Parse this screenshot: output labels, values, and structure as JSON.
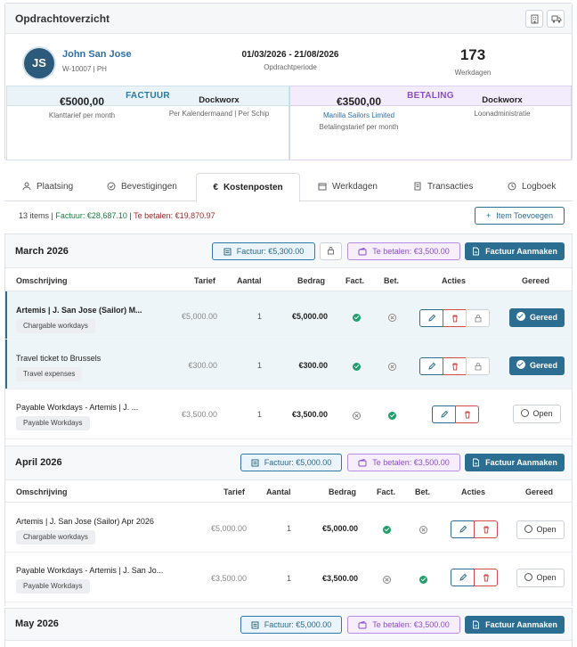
{
  "header": {
    "title": "Opdrachtoverzicht"
  },
  "contractor": {
    "initials": "JS",
    "name": "John San Jose",
    "meta": "W-10007 | PH"
  },
  "period": {
    "range": "01/03/2026 - 21/08/2026",
    "label": "Opdrachtperiode"
  },
  "workdays": {
    "value": "173",
    "label": "Werkdagen"
  },
  "factuur": {
    "heading": "FACTUUR",
    "rate": "€5000,00",
    "rate_label": "Klanttarief per month",
    "client": "Dockworx",
    "client_label": "Per Kalendermaand | Per Schip"
  },
  "betaling": {
    "heading": "BETALING",
    "rate": "€3500,00",
    "payer": "Manilla Sailors Limited",
    "rate_label": "Betalingstarief per month",
    "admin": "Dockworx",
    "admin_label": "Loonadministratie"
  },
  "tabs": [
    "Plaatsing",
    "Bevestigingen",
    "Kostenposten",
    "Werkdagen",
    "Transacties",
    "Logboek"
  ],
  "summary": {
    "items": "13 items",
    "factuur": "Factuur: €28,687.10",
    "betalen": "Te betalen: €19,870.97"
  },
  "add_button": "Item Toevoegen",
  "columns": {
    "desc": "Omschrijving",
    "rate": "Tarief",
    "qty": "Aantal",
    "amount": "Bedrag",
    "fact": "Fact.",
    "bet": "Bet.",
    "actions": "Acties",
    "done": "Gereed"
  },
  "make_invoice": "Factuur Aanmaken",
  "months": [
    {
      "title": "March 2026",
      "factuur": "Factuur: €5,300.00",
      "betalen": "Te betalen: €3,500.00",
      "rows": [
        {
          "desc": "Artemis | J. San Jose (Sailor) M...",
          "tag": "Chargable workdays",
          "rate": "€5,000.00",
          "qty": "1",
          "amount": "€5,000.00",
          "done": "Gereed"
        },
        {
          "desc": "Travel ticket to Brussels",
          "tag": "Travel expenses",
          "rate": "€300.00",
          "qty": "1",
          "amount": "€300.00",
          "done": "Gereed"
        },
        {
          "desc": "Payable Workdays - Artemis | J. ...",
          "tag": "Payable Workdays",
          "rate": "€3,500.00",
          "qty": "1",
          "amount": "€3,500.00",
          "done": "Open"
        }
      ]
    },
    {
      "title": "April 2026",
      "factuur": "Factuur: €5,000.00",
      "betalen": "Te betalen: €3,500.00",
      "rows": [
        {
          "desc": "Artemis | J. San Jose (Sailor) Apr 2026",
          "tag": "Chargable workdays",
          "rate": "€5,000.00",
          "qty": "1",
          "amount": "€5,000.00",
          "done": "Open"
        },
        {
          "desc": "Payable Workdays - Artemis | J. San Jo...",
          "tag": "Payable Workdays",
          "rate": "€3,500.00",
          "qty": "1",
          "amount": "€3,500.00",
          "done": "Open"
        }
      ]
    },
    {
      "title": "May 2026",
      "factuur": "Factuur: €5,000.00",
      "betalen": "Te betalen: €3,500.00"
    }
  ]
}
